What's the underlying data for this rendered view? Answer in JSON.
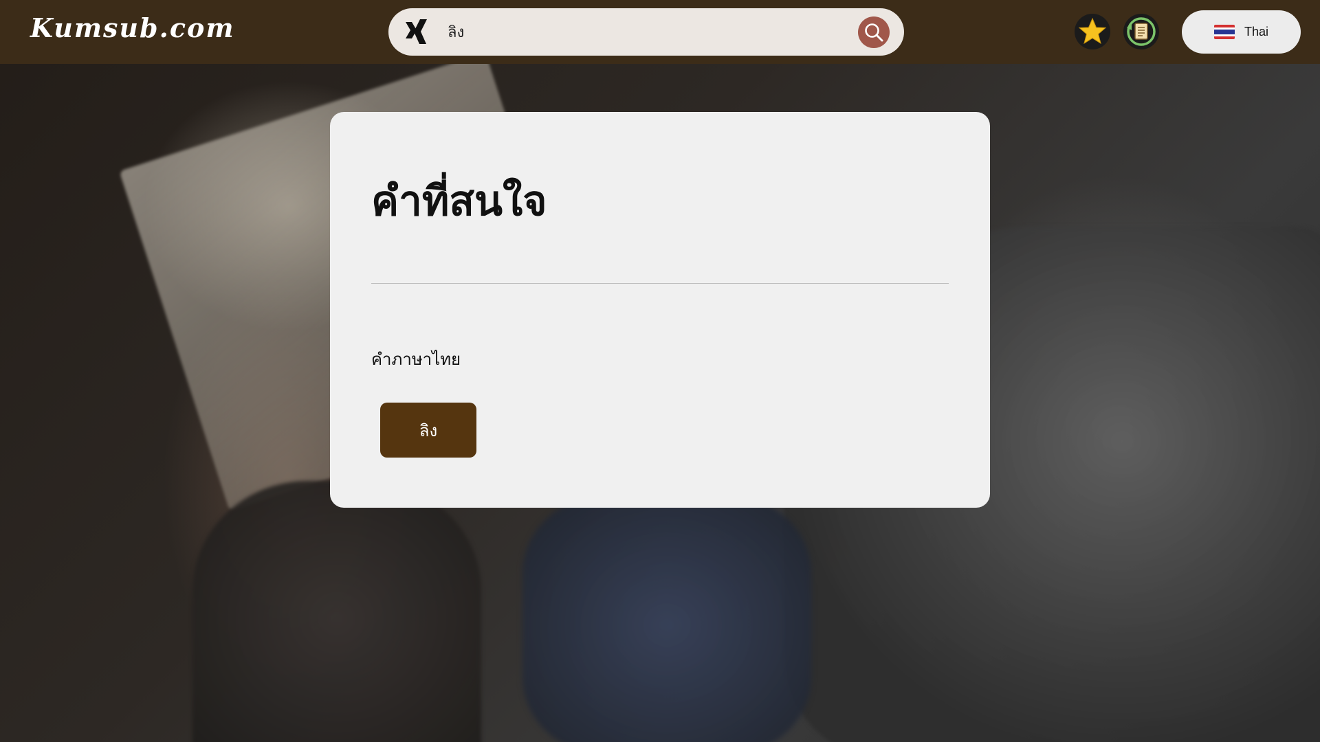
{
  "header": {
    "logo": "Kumsub.com",
    "search": {
      "value": "ลิง",
      "placeholder": ""
    },
    "icons": {
      "left": "xing-icon",
      "search": "search-icon",
      "favorites": "star-icon",
      "history": "history-scroll-icon",
      "flag": "thai-flag-icon"
    },
    "language_label": "Thai"
  },
  "card": {
    "title": "คำที่สนใจ",
    "section_label": "คำภาษาไทย",
    "words": [
      "ลิง"
    ]
  },
  "colors": {
    "header_bg": "#3c2c18",
    "search_button": "#a0574a",
    "word_chip": "#55350f",
    "card_bg": "#f0f0f0",
    "star": "#f6c11f",
    "history_ring": "#7cc46a"
  }
}
